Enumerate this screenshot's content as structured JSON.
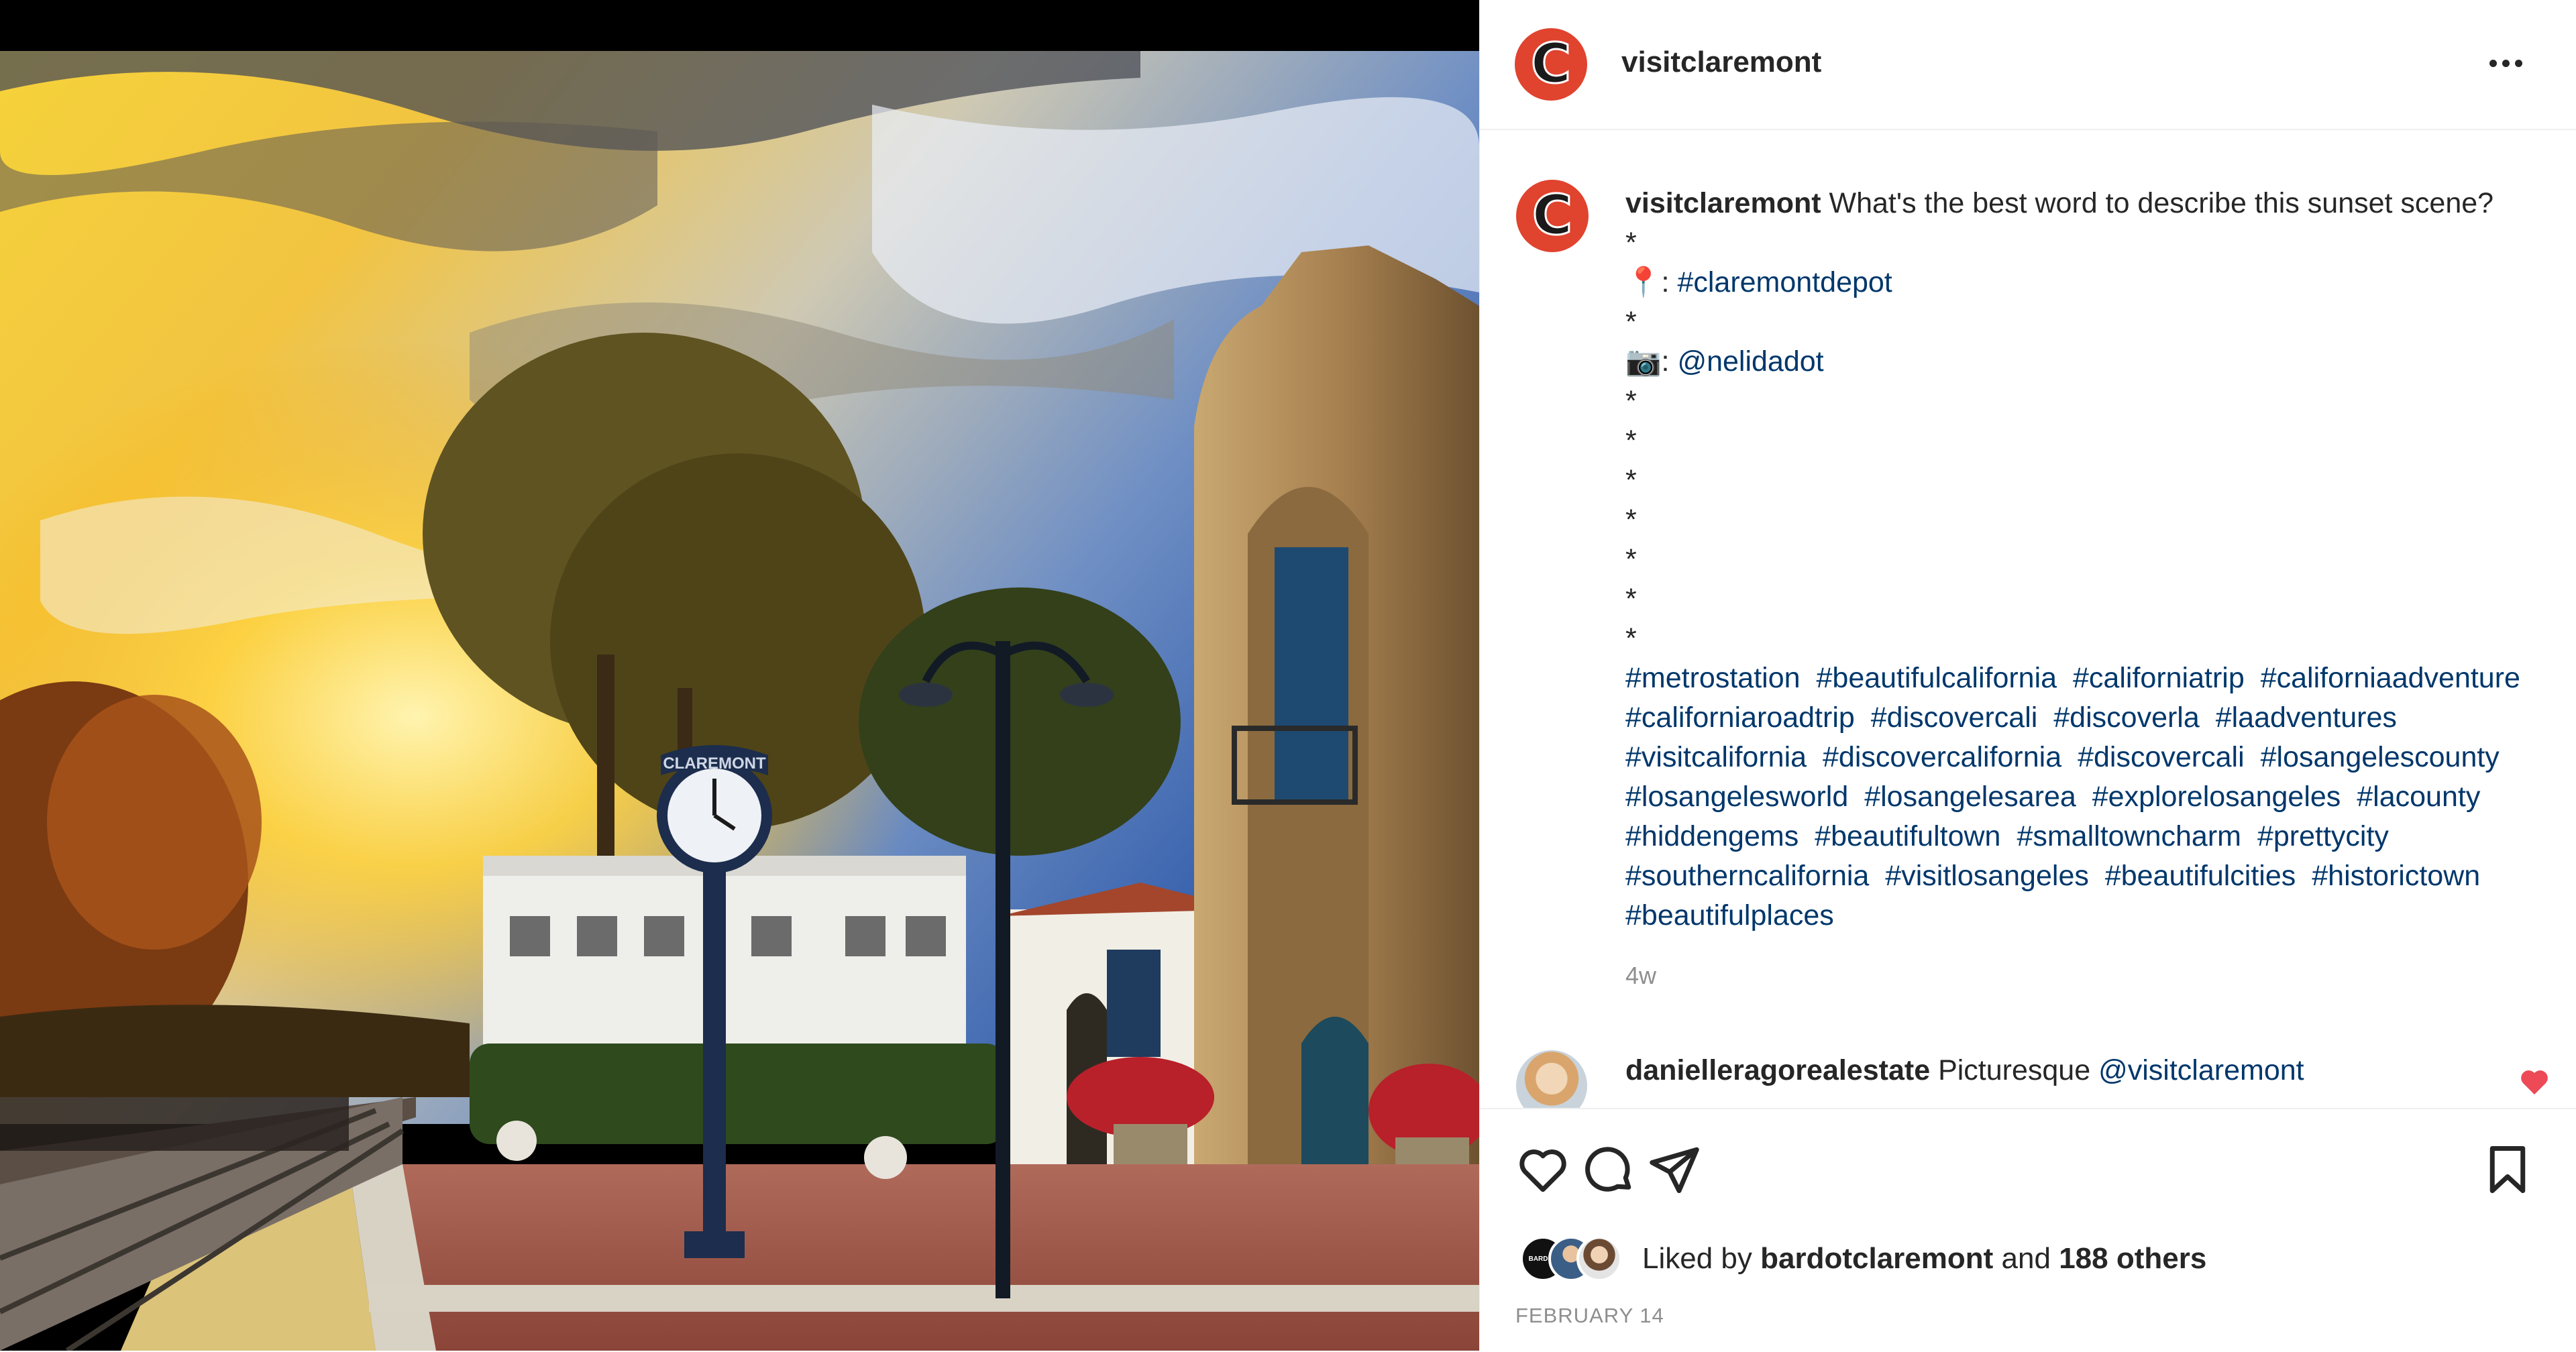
{
  "post": {
    "username": "visitclaremont",
    "avatar_letter": "C",
    "more_icon": "more-horizontal-icon",
    "photo": {
      "clock_sign_text": "CLAREMONT"
    }
  },
  "caption": {
    "username": "visitclaremont",
    "text": "What's the best word to describe this sunset scene?",
    "star": "*",
    "location_prefix": "📍: ",
    "location_tag": "#claremontdepot",
    "camera_prefix": "📷: ",
    "photographer": "@nelidadot",
    "stars_after": [
      "*",
      "*",
      "*",
      "*",
      "*",
      "*",
      "*"
    ],
    "hashtags": [
      "#metrostation",
      "#beautifulcalifornia",
      "#californiatrip",
      "#californiaadventure",
      "#californiaroadtrip",
      "#discovercali",
      "#discoverla",
      "#laadventures",
      "#visitcalifornia",
      "#discovercalifornia",
      "#discovercali",
      "#losangelescounty",
      "#losangelesworld",
      "#losangelesarea",
      "#explorelosangeles",
      "#lacounty",
      "#hiddengems",
      "#beautifultown",
      "#smalltowncharm",
      "#prettycity",
      "#southerncalifornia",
      "#visitlosangeles",
      "#beautifulcities",
      "#historictown",
      "#beautifulplaces"
    ],
    "time": "4w"
  },
  "comment": {
    "username": "danielleragorealestate",
    "text": "Picturesque",
    "mention": "@visitclaremont",
    "liked": true
  },
  "actions": {
    "like_icon": "heart-icon",
    "comment_icon": "comment-icon",
    "share_icon": "share-icon",
    "save_icon": "bookmark-icon"
  },
  "likes": {
    "prefix": "Liked by",
    "user": "bardotclaremont",
    "and": "and",
    "others": "188 others",
    "avatar1_text": "BARDOT"
  },
  "date": "FEBRUARY 14",
  "colors": {
    "brand": "#e0432e",
    "link": "#00376b",
    "liked_heart": "#ed4956"
  }
}
